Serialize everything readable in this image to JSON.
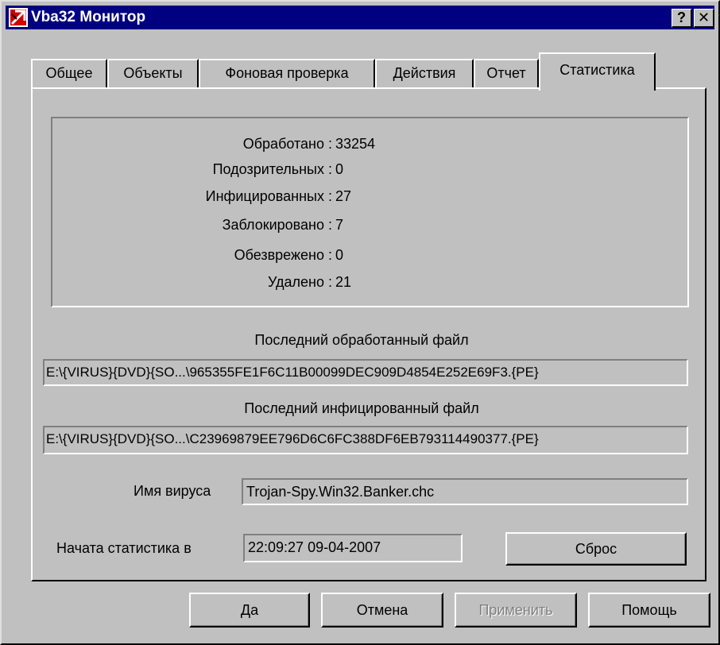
{
  "window": {
    "title": "Vba32 Монитор",
    "help_label": "?",
    "close_label": "✕"
  },
  "tabs": [
    {
      "label": "Общее",
      "active": false
    },
    {
      "label": "Объекты",
      "active": false
    },
    {
      "label": "Фоновая проверка",
      "active": false
    },
    {
      "label": "Действия",
      "active": false
    },
    {
      "label": "Отчет",
      "active": false
    },
    {
      "label": "Статистика",
      "active": true
    }
  ],
  "stats": [
    {
      "label": "Обработано :",
      "value": "33254"
    },
    {
      "label": "Подозрительных :",
      "value": "0"
    },
    {
      "label": "Инфицированных :",
      "value": "27"
    },
    {
      "label": "Заблокировано :",
      "value": "7"
    },
    {
      "label": "Обезврежено :",
      "value": "0"
    },
    {
      "label": "Удалено :",
      "value": "21"
    }
  ],
  "last_processed": {
    "label": "Последний обработанный файл",
    "value": "E:\\{VIRUS}{DVD}{SO...\\965355FE1F6C11B00099DEC909D4854E252E69F3.{PE}"
  },
  "last_infected": {
    "label": "Последний инфицированный файл",
    "value": "E:\\{VIRUS}{DVD}{SO...\\C23969879EE796D6C6FC388DF6EB793114490377.{PE}"
  },
  "virus_name": {
    "label": "Имя вируса",
    "value": "Trojan-Spy.Win32.Banker.chc"
  },
  "stats_start": {
    "label": "Начата статистика в",
    "value": "22:09:27  09-04-2007"
  },
  "buttons": {
    "reset": "Сброс",
    "ok": "Да",
    "cancel": "Отмена",
    "apply": "Применить",
    "help": "Помощь"
  },
  "icons": {
    "app": "vba32-app-icon",
    "help": "help-icon",
    "close": "close-icon"
  },
  "colors": {
    "titlebar": "#000080",
    "face": "#c0c0c0",
    "disabled_text": "#808080"
  }
}
